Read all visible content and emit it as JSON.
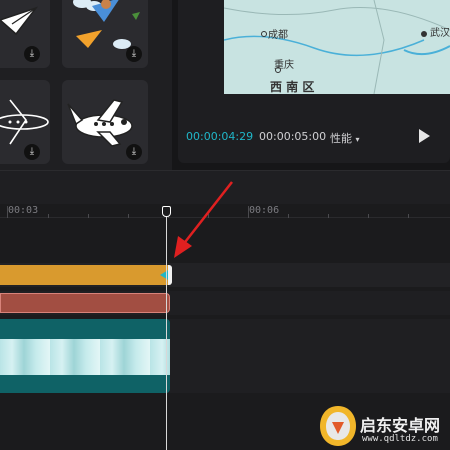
{
  "player": {
    "current_time": "00:00:04:29",
    "total_time": "00:00:05:00",
    "ratio_label": "性能",
    "map_labels": [
      "成都",
      "重庆",
      "西 南 区",
      "武汉"
    ]
  },
  "timeline": {
    "ruler_labels": [
      "00:03",
      "00:06"
    ]
  },
  "watermark": {
    "text": "启东安卓网",
    "url": "www.qdltdz.com"
  },
  "colors": {
    "accent": "#20b6c8",
    "audio_clip": "#d99a2e",
    "text_clip": "#a24e42",
    "video_clip": "#0f6266",
    "arrow": "#e02020"
  },
  "icons": [
    "paper-plane-icon",
    "download-icon",
    "airplane-icon",
    "play-icon",
    "dropdown-icon"
  ]
}
